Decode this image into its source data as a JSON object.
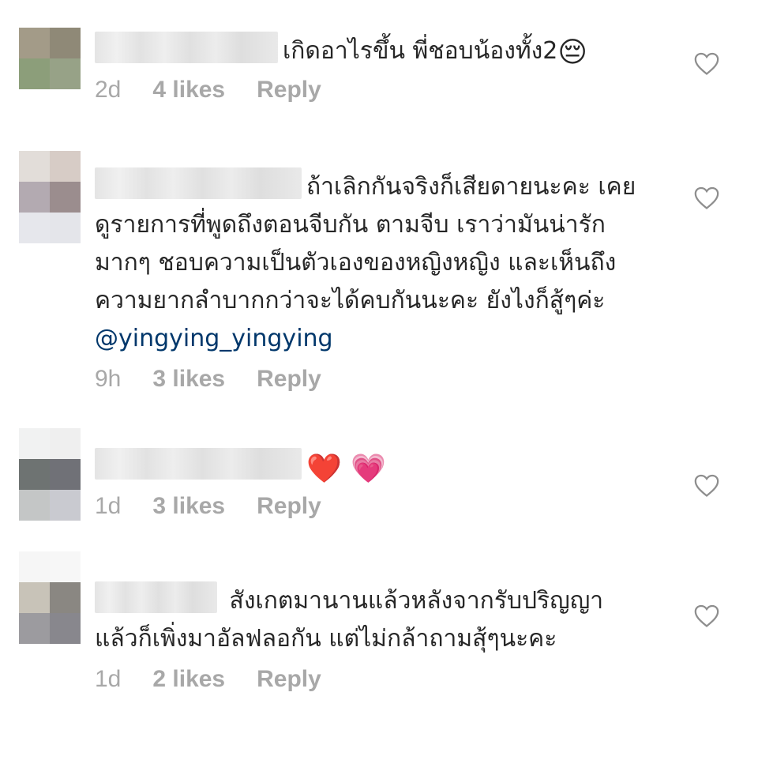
{
  "colors": {
    "text": "#262626",
    "meta": "#a8a8a8",
    "mention": "#00376b",
    "heart_outline": "#8e8e8e"
  },
  "comments": [
    {
      "username": "",
      "text": "เกิดอาไรขึ้น พี่ชอบน้องทั้ง2",
      "emoji": "😔",
      "time": "2d",
      "likes": "4 likes",
      "reply_label": "Reply",
      "avatar_colors": [
        "#a39b88",
        "#8f8977",
        "#8c9e7a",
        "#97a287",
        "#ffffff",
        "#ffffff",
        "#fafafa",
        "#ffffff"
      ]
    },
    {
      "username": "",
      "text": "ถ้าเลิกกันจริงก็เสียดายนะคะ เคยดูรายการที่พูดถึงตอนจีบกัน ตามจีบ เราว่ามันน่ารักมากๆ ชอบความเป็นตัวเองของหญิงหญิง และเห็นถึงความยากลำบากกว่าจะได้คบกันนะคะ ยังไงก็สู้ๆค่ะ",
      "mention": "@yingying_yingying",
      "time": "9h",
      "likes": "3 likes",
      "reply_label": "Reply",
      "avatar_colors": [
        "#e2ddd9",
        "#d7ccc6",
        "#b3aab1",
        "#9b8d8e",
        "#e6e7ec",
        "#e4e5ea"
      ]
    },
    {
      "username": "",
      "text": "",
      "emoji": "❤️ 💗",
      "time": "1d",
      "likes": "3 likes",
      "reply_label": "Reply",
      "avatar_colors": [
        "#f1f2f2",
        "#efefef",
        "#6e7372",
        "#707177",
        "#c4c6c6",
        "#c9cad0"
      ]
    },
    {
      "username": "",
      "text": "สังเกตมานานแล้วหลังจากรับปริญญา แล้วก็เพิ่งมาอัลฟลอกัน แต่ไม่กล้าถามสุ้ๆนะคะ",
      "time": "1d",
      "likes": "2 likes",
      "reply_label": "Reply",
      "avatar_colors": [
        "#f6f6f6",
        "#f7f7f7",
        "#c8c3b8",
        "#8a8782",
        "#9c9b9f",
        "#88878d"
      ]
    }
  ]
}
